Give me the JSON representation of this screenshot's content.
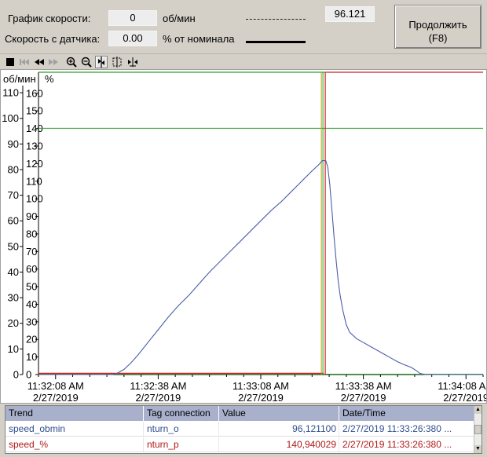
{
  "header": {
    "speed_chart_label": "График скорости:",
    "speed_chart_value": "0",
    "speed_chart_unit": "об/мин",
    "sensor_speed_label": "Скорость с датчика:",
    "sensor_speed_value": "0.00",
    "sensor_speed_unit": "% от номинала",
    "readout_value": "96.121",
    "continue_button_line1": "Продолжить",
    "continue_button_line2": "(F8)"
  },
  "toolbar": {
    "icons": [
      "stop-icon",
      "first-icon",
      "rewind-icon",
      "forward-icon",
      "zoom-in-icon",
      "zoom-out-icon",
      "ruler-icon",
      "select-area-icon",
      "move-icon"
    ]
  },
  "chart_data": {
    "type": "line",
    "left_axis_label": "об/мин",
    "right_axis_label": "%",
    "left_ticks": [
      "0",
      "10",
      "20",
      "30",
      "40",
      "50",
      "60",
      "70",
      "80",
      "90",
      "100",
      "110"
    ],
    "right_ticks": [
      "0",
      "10",
      "20",
      "30",
      "40",
      "50",
      "60",
      "70",
      "80",
      "90",
      "100",
      "110",
      "120",
      "130",
      "140",
      "150",
      "160"
    ],
    "left_ylim": [
      0,
      118
    ],
    "right_ylim": [
      0,
      172
    ],
    "x_ticks": [
      {
        "time": "11:32:08 AM",
        "date": "2/27/2019"
      },
      {
        "time": "11:32:38 AM",
        "date": "2/27/2019"
      },
      {
        "time": "11:33:08 AM",
        "date": "2/27/2019"
      },
      {
        "time": "11:33:38 AM",
        "date": "2/27/2019"
      },
      {
        "time": "11:34:08 AM",
        "date": "2/27/2019"
      }
    ],
    "x_seconds": [
      0,
      30,
      60,
      90,
      120
    ],
    "xlim": [
      -5,
      125
    ],
    "cursor_time_seconds": 78.4,
    "cursor_value_rpm": 96.121,
    "series": [
      {
        "name": "speed_obmin",
        "color": "#4a5ea8",
        "points": [
          [
            -5,
            0
          ],
          [
            16.7,
            0
          ],
          [
            18,
            0.5
          ],
          [
            20,
            2
          ],
          [
            22,
            4.5
          ],
          [
            24,
            7.5
          ],
          [
            27,
            12.5
          ],
          [
            30,
            17.5
          ],
          [
            33,
            22.5
          ],
          [
            36,
            27
          ],
          [
            39,
            31
          ],
          [
            42,
            35.5
          ],
          [
            45,
            40
          ],
          [
            48,
            44
          ],
          [
            51,
            48
          ],
          [
            54,
            52
          ],
          [
            57,
            56
          ],
          [
            60,
            60
          ],
          [
            63,
            64
          ],
          [
            66,
            67.5
          ],
          [
            69,
            71.5
          ],
          [
            72,
            75.5
          ],
          [
            75,
            79.5
          ],
          [
            77,
            82
          ],
          [
            78,
            83.5
          ],
          [
            79,
            83.5
          ],
          [
            79.6,
            81
          ],
          [
            80.2,
            74
          ],
          [
            80.8,
            64
          ],
          [
            81.4,
            54
          ],
          [
            82,
            45
          ],
          [
            82.6,
            37
          ],
          [
            83.2,
            31
          ],
          [
            84,
            25
          ],
          [
            85,
            19.5
          ],
          [
            86,
            16.5
          ],
          [
            88,
            14
          ],
          [
            90,
            12.5
          ],
          [
            92,
            11
          ],
          [
            94,
            9.5
          ],
          [
            96,
            8
          ],
          [
            98,
            6.5
          ],
          [
            100,
            5
          ],
          [
            102,
            3.8
          ],
          [
            104,
            2.8
          ],
          [
            105.5,
            1.5
          ],
          [
            106.5,
            0.5
          ],
          [
            108,
            0
          ],
          [
            125,
            0
          ]
        ]
      }
    ]
  },
  "legend": {
    "headers": [
      "Trend",
      "Tag connection",
      "Value",
      "Date/Time"
    ],
    "rows": [
      {
        "trend": "speed_obmin",
        "tag": "nturn_o",
        "value": "96,121100",
        "datetime": "2/27/2019 11:33:26:380 ...",
        "color": "#2f4f8f"
      },
      {
        "trend": "speed_%",
        "tag": "nturn_p",
        "value": "140,940029",
        "datetime": "2/27/2019 11:33:26:380 ...",
        "color": "#b01818"
      }
    ]
  },
  "colors": {
    "blue_trend": "#4a5ea8",
    "red_cursor": "#cc2222",
    "green_cursor": "#2aa02a",
    "olive_cursor": "#b5a000"
  }
}
